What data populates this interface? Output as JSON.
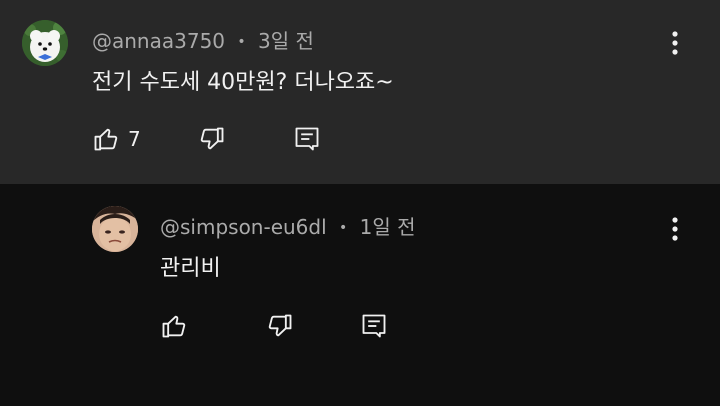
{
  "comments": [
    {
      "author": "@annaa3750",
      "time": "3일 전",
      "text": "전기 수도세 40만원? 더나오죠~",
      "likes": "7",
      "avatar_icon": "white-dog-avatar",
      "colors": {
        "card_bg": "#282828",
        "meta": "#aaaaaa"
      }
    },
    {
      "author": "@simpson-eu6dl",
      "time": "1일 전",
      "text": "관리비",
      "likes": "",
      "avatar_icon": "face-avatar",
      "colors": {
        "card_bg": "#0f0f0f",
        "meta": "#aaaaaa"
      }
    }
  ],
  "icons": {
    "like": "thumb-up-icon",
    "dislike": "thumb-down-icon",
    "reply": "reply-icon",
    "menu": "more-vert-icon"
  },
  "separator": "•"
}
